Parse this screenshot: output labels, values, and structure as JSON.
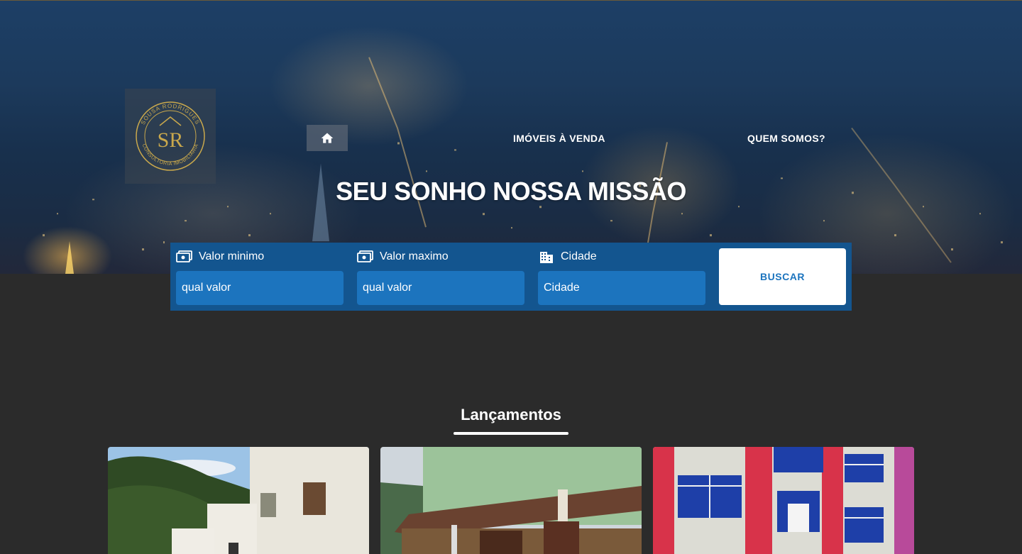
{
  "header": {
    "logo": {
      "name": "logo-sousa-rodrigues",
      "ring_text_top": "SOUSA RODRIGUES",
      "ring_text_bottom": "CONSULTORIA IMOBILIARIA",
      "monogram": "SR",
      "color": "#c9a84c"
    },
    "home_icon": "home-icon",
    "nav": {
      "imoveis_label": "IMÓVEIS À VENDA",
      "quem_label": "QUEM SOMOS?"
    }
  },
  "hero": {
    "title": "SEU SONHO NOSSA MISSÃO"
  },
  "search": {
    "min": {
      "label": "Valor minimo",
      "value": "qual valor",
      "icon": "money-icon"
    },
    "max": {
      "label": "Valor maximo",
      "value": "qual valor",
      "icon": "money-icon"
    },
    "city": {
      "label": "Cidade",
      "value": "Cidade",
      "icon": "building-icon"
    },
    "button_label": "BUSCAR"
  },
  "launches": {
    "title": "Lançamentos",
    "cards": [
      {
        "name": "property-card-1"
      },
      {
        "name": "property-card-2"
      },
      {
        "name": "property-card-3"
      }
    ]
  },
  "colors": {
    "page_bg": "#2b2b2b",
    "panel_bg": "#13558f",
    "input_bg": "#1c74be",
    "accent_text": "#1c74be",
    "logo_gold": "#c9a84c"
  }
}
